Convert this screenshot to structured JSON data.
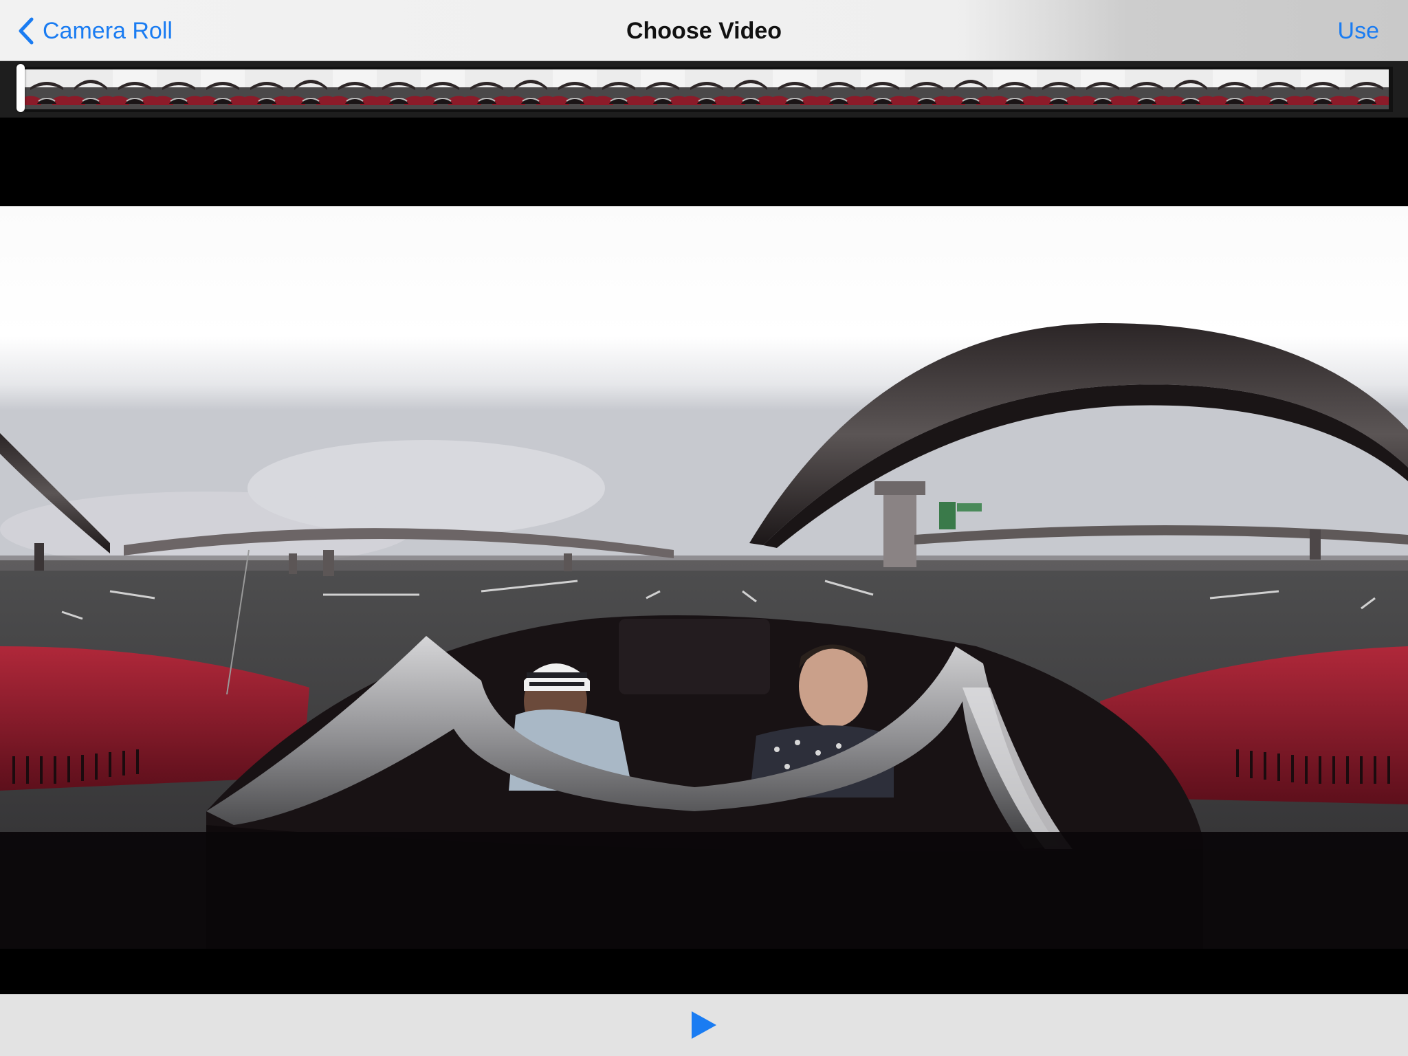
{
  "navbar": {
    "back_label": "Camera Roll",
    "back_icon": "chevron-left-icon",
    "title": "Choose Video",
    "use_label": "Use"
  },
  "filmstrip": {
    "frame_count": 31,
    "playhead_position": 0.0
  },
  "video": {
    "content": "360-degree equirectangular frame: two people in a red convertible on a highway under overpasses"
  },
  "toolbar": {
    "play_icon": "play-icon"
  },
  "colors": {
    "accent": "#1a7cf2",
    "navbar_bg": "#f2f2f2",
    "toolbar_bg": "#e3e3e3",
    "video_bg": "#000000",
    "car_red": "#9a1d2a"
  }
}
